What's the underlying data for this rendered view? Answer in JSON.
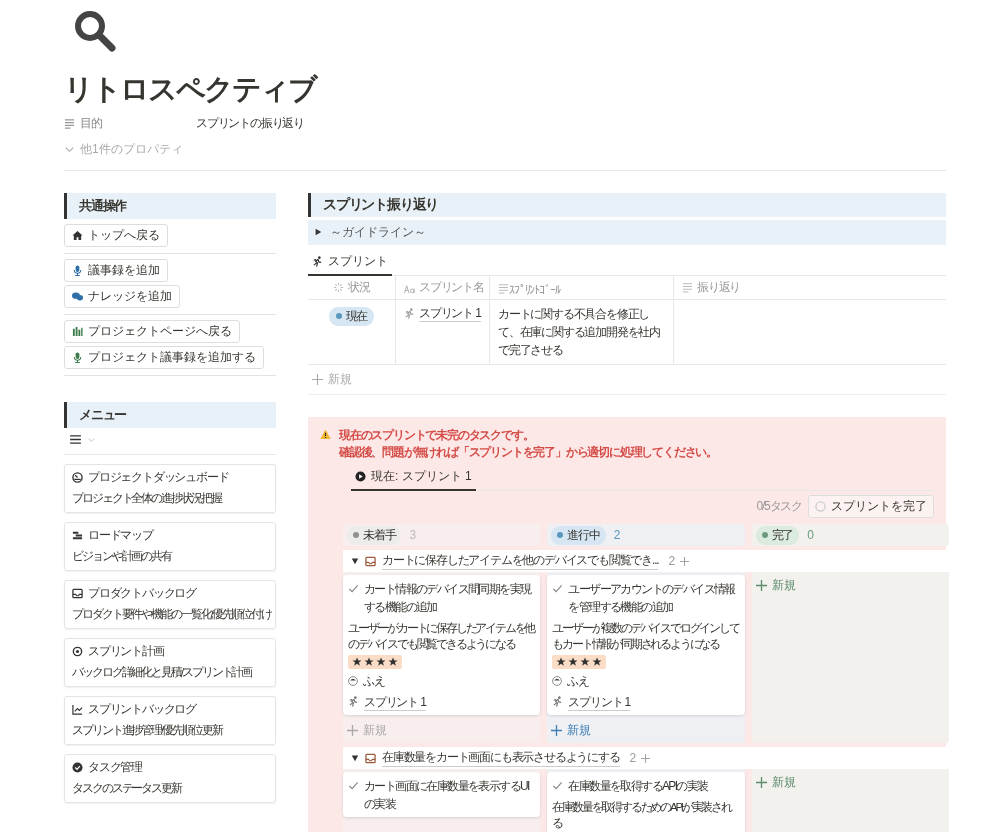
{
  "page": {
    "title": "リトロスペクティブ",
    "properties": [
      {
        "label": "目的",
        "value": "スプリントの振り返り"
      }
    ],
    "more_properties": "他1件のプロパティ"
  },
  "common_actions": {
    "heading": "共通操作",
    "groups": [
      [
        "トップへ戻る"
      ],
      [
        "議事録を追加",
        "ナレッジを追加"
      ],
      [
        "プロジェクトページへ戻る",
        "プロジェクト議事録を追加する"
      ]
    ]
  },
  "menu": {
    "heading": "メニュー",
    "items": [
      {
        "title": "プロジェクトダッシュボード",
        "description": "プロジェクト全体の進捗状況把握"
      },
      {
        "title": "ロードマップ",
        "description": "ビジョンや計画の共有"
      },
      {
        "title": "プロダクトバックログ",
        "description": "プロダクト要件や機能の一覧化/優先順位付け"
      },
      {
        "title": "スプリント計画",
        "description": "バックログ詳細化と見積/スプリント計画"
      },
      {
        "title": "スプリントバックログ",
        "description": "スプリント進捗管理/優先順位更新"
      },
      {
        "title": "タスク管理",
        "description": "タスクのステータス更新"
      }
    ]
  },
  "retro": {
    "heading": "スプリント振り返り",
    "toggle": "～ガイドライン～",
    "view_tabs": [
      {
        "label": "スプリント",
        "selected": true
      }
    ],
    "columns": [
      "状況",
      "スプリント名",
      "ｽﾌﾟﾘﾝﾄｺﾞｰﾙ",
      "振り返り"
    ],
    "rows": [
      {
        "status": "現在",
        "name": "スプリント 1",
        "goal": "カートに関する不具合を修正して、在庫に関する追加開発を社内で完了させる"
      }
    ],
    "new": "新規"
  },
  "callout": {
    "lines": [
      "現在のスプリントで未完のタスクです。",
      "確認後、問題が無ければ「スプリントを完了」から適切に処理してください。"
    ],
    "tabs": [
      {
        "label": "現在: スプリント 1",
        "selected": true
      }
    ],
    "count": "0/5タスク",
    "complete_button": "スプリントを完了",
    "statuses": [
      {
        "label": "未着手",
        "count": "3",
        "color": "#91918e"
      },
      {
        "label": "進行中",
        "count": "2",
        "color": "#5b97bd"
      },
      {
        "label": "完了",
        "count": "0",
        "color": "#6c9b7d"
      }
    ],
    "groups": [
      {
        "title": "カートに保存したアイテムを他のデバイスでも閲覧でき...",
        "count": "2",
        "lanes": [
          {
            "cards": [
              {
                "title": "カート情報のデバイス間同期を実現する機能の追加",
                "description": "ユーザーがカートに保存したアイテムを他のデバイスでも閲覧できるようになる",
                "stars": 4,
                "assignee": "ふえ",
                "sprint": "スプリント 1"
              }
            ],
            "new": "新規"
          },
          {
            "cards": [
              {
                "title": "ユーザーアカウントのデバイス情報を管理する機能の追加",
                "description": "ユーザーが複数のデバイスでログインしてもカート情報が同期されるようになる",
                "stars": 4,
                "assignee": "ふえ",
                "sprint": "スプリント 1"
              }
            ],
            "new": "新規"
          },
          {
            "new": "新規"
          }
        ]
      },
      {
        "title": "在庫数量をカート画面にも表示させるようにする",
        "count": "2",
        "lanes": [
          {
            "cards": [
              {
                "title": "カート画面に在庫数量を表示するUIの実装"
              }
            ]
          },
          {
            "cards": [
              {
                "title": "在庫数量を取得するAPIの実装",
                "description": "在庫数量を取得するためのAPIが実装される"
              }
            ]
          },
          {
            "new": "新規"
          }
        ]
      }
    ]
  }
}
